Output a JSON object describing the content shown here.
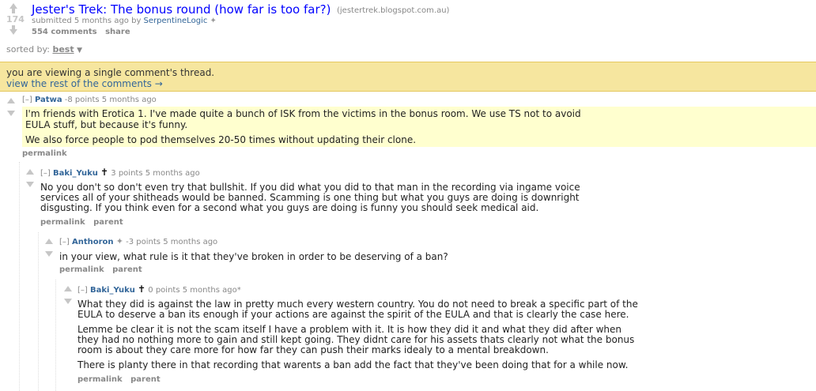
{
  "post": {
    "score": "174",
    "title": "Jester's Trek: The bonus round (how far is too far?)",
    "domain": "(jestertrek.blogspot.com.au)",
    "submitted": "submitted 5 months ago by",
    "submitter": "SerpentineLogic",
    "comments_label": "554 comments",
    "share_label": "share"
  },
  "sort": {
    "label": "sorted by:",
    "value": "best"
  },
  "notice": {
    "text": "you are viewing a single comment's thread.",
    "link": "view the rest of the comments →"
  },
  "comments": [
    {
      "toggle": "[–]",
      "author": "Patwa",
      "meta": "-8 points 5 months ago",
      "lines": [
        "I'm friends with Erotica 1. I've made quite a bunch of ISK from the victims in the bonus room. We use TS not to avoid",
        "EULA stuff, but because it's funny.",
        "We also force people to pod themselves 20-50 times without updating their clone."
      ],
      "buttons": [
        "permalink"
      ]
    },
    {
      "toggle": "[–]",
      "author": "Baki_Yuku",
      "meta": "3 points 5 months ago",
      "lines": [
        "No you don't so don't even try that bullshit. If you did what you did to that man in the recording via ingame voice",
        "services all of your shitheads would be banned. Scamming is one thing but what you guys are doing is downright",
        "disgusting. If you think even for a second what you guys are doing is funny you should seek medical aid."
      ],
      "buttons": [
        "permalink",
        "parent"
      ]
    },
    {
      "toggle": "[–]",
      "author": "Anthoron",
      "meta": "-3 points 5 months ago",
      "lines": [
        "in your view, what rule is it that they've broken in order to be deserving of a ban?"
      ],
      "buttons": [
        "permalink",
        "parent"
      ]
    },
    {
      "toggle": "[–]",
      "author": "Baki_Yuku",
      "meta": "0 points 5 months ago*",
      "lines": [
        "What they did is against the law in pretty much every western country. You do not need to break a specific part of the",
        "EULA to deserve a ban its enough if your actions are against the spirit of the EULA and that is clearly the case here.",
        "Lemme be clear it is not the scam itself I have a problem with it. It is how they did it and what they did after when",
        "they had no nothing more to gain and still kept going. They didnt care for his assets thats clearly not what the bonus",
        "room is about they care more for how far they can push their marks idealy to a mental breakdown.",
        "There is planty there in that recording that warents a ban add the fact that they've been doing that for a while now."
      ],
      "buttons": [
        "permalink",
        "parent"
      ]
    }
  ]
}
